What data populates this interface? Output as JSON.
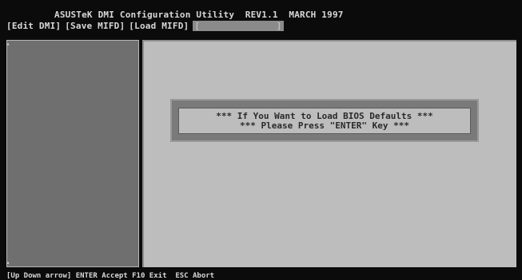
{
  "title": "ASUSTeK DMI Configuration Utility  REV1.1  MARCH 1997",
  "menu": [
    {
      "label": "[Edit DMI]"
    },
    {
      "label": "[Save MIFD]"
    },
    {
      "label": "[Load MIFD]"
    },
    {
      "label": "[              ]"
    }
  ],
  "dialog": {
    "line1": "*** If You Want to Load BIOS Defaults ***",
    "line2": "*** Please Press \"ENTER\" Key ***"
  },
  "status": "[Up Down arrow] ENTER Accept F10 Exit  ESC Abort"
}
